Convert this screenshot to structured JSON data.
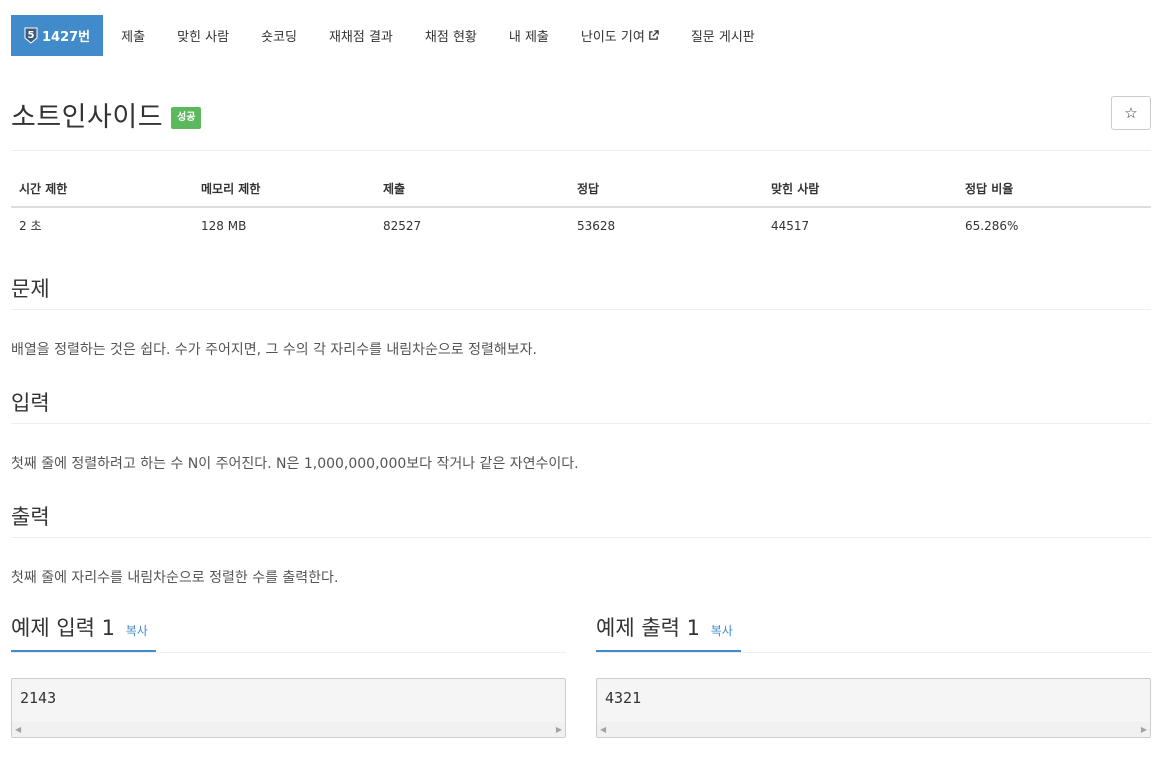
{
  "nav": {
    "problem_tier": "5",
    "problem_number": "1427번",
    "tabs": [
      "제출",
      "맞힌 사람",
      "숏코딩",
      "재채점 결과",
      "채점 현황",
      "내 제출",
      "난이도 기여",
      "질문 게시판"
    ],
    "tier_color": "#3d5a80",
    "active_color": "#428bca"
  },
  "problem": {
    "title": "소트인사이드",
    "status_badge": "성공",
    "status_color": "#5cb85c",
    "star_icon": "☆"
  },
  "info_table": {
    "headers": [
      "시간 제한",
      "메모리 제한",
      "제출",
      "정답",
      "맞힌 사람",
      "정답 비율"
    ],
    "values": [
      "2 초",
      "128 MB",
      "82527",
      "53628",
      "44517",
      "65.286%"
    ]
  },
  "sections": {
    "description": {
      "heading": "문제",
      "text": "배열을 정렬하는 것은 쉽다. 수가 주어지면, 그 수의 각 자리수를 내림차순으로 정렬해보자."
    },
    "input": {
      "heading": "입력",
      "text": "첫째 줄에 정렬하려고 하는 수 N이 주어진다. N은 1,000,000,000보다 작거나 같은 자연수이다."
    },
    "output": {
      "heading": "출력",
      "text": "첫째 줄에 자리수를 내림차순으로 정렬한 수를 출력한다."
    }
  },
  "samples": [
    {
      "title": "예제 입력 1",
      "copy_label": "복사",
      "content": "2143"
    },
    {
      "title": "예제 출력 1",
      "copy_label": "복사",
      "content": "4321"
    }
  ]
}
